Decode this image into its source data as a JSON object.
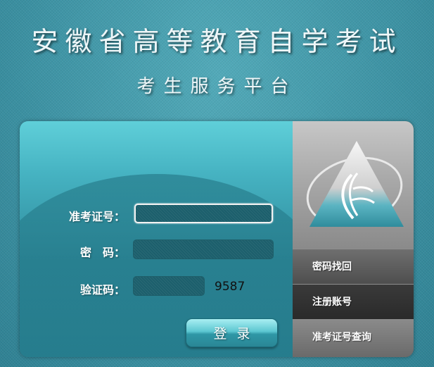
{
  "header": {
    "title": "安徽省高等教育自学考试",
    "subtitle": "考生服务平台"
  },
  "login": {
    "fields": {
      "exam_id_label": "准考证号：",
      "password_label": "密　码：",
      "captcha_label": "验证码："
    },
    "exam_id_value": "",
    "password_value": "",
    "captcha_input_value": "",
    "captcha_code": "9587",
    "submit_label": "登录"
  },
  "side": {
    "links": [
      {
        "label": "密码找回"
      },
      {
        "label": "注册账号"
      },
      {
        "label": "准考证号查询"
      }
    ]
  },
  "colors": {
    "background": "#3f98a8",
    "panel_accent": "#46b3c2",
    "side_panel": "#4d4d4d"
  }
}
